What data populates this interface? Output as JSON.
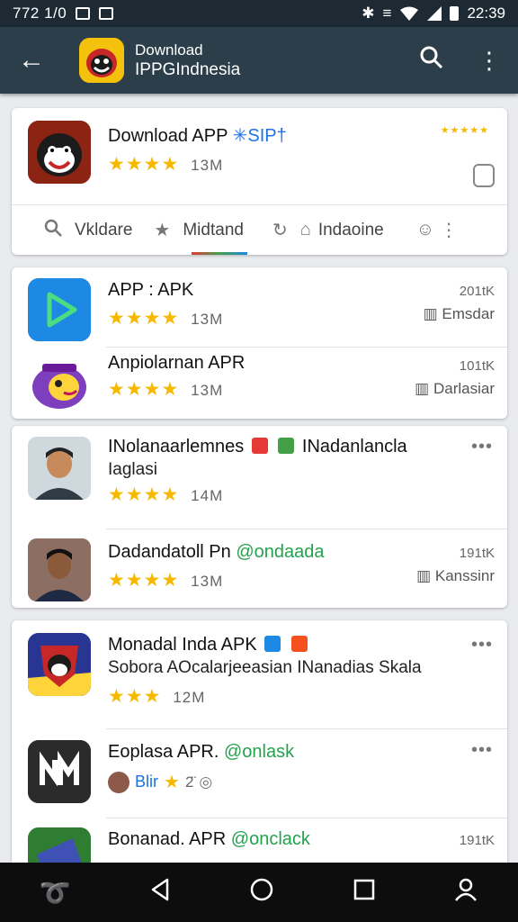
{
  "status_bar": {
    "time_left": "772 1/0",
    "time_right": "22:39"
  },
  "app_bar": {
    "title_line1": "Download",
    "title_line2": "IPPGIndnesia"
  },
  "featured": {
    "name": "Download APP",
    "tag": "✳SIP†",
    "stars": "★★★★",
    "meta": "13M",
    "small_stars": "★★★★★"
  },
  "tabs": [
    {
      "label": "Vkldare"
    },
    {
      "label": "Midtand"
    },
    {
      "label": "Indaoine"
    }
  ],
  "apps": [
    {
      "name": "APP : APK",
      "stars": "★★★★",
      "meta": "13M",
      "size": "201tK",
      "location": "Emsdar"
    },
    {
      "name": "Anpiolarnan APR",
      "stars": "★★★★",
      "meta": "13M",
      "size": "101tK",
      "location": "Darlasiar"
    },
    {
      "name": "INolanaarlemnes",
      "name_tail": "INadanlancla",
      "line2": "Iaglasi",
      "stars": "★★★★",
      "meta": "14M"
    },
    {
      "name": "Dadandatoll Pn",
      "tag": "@ondaada",
      "stars": "★★★★",
      "meta": "13M",
      "size": "191tK",
      "location": "Kanssinr"
    },
    {
      "name": "Monadal Inda APK",
      "line2": "Sobora  AOcalarjeeasian INanadias Skala",
      "stars": "★★★",
      "meta": "12M"
    },
    {
      "name": "Eoplasa APR.",
      "tag": "@onlask",
      "line2": "Blir",
      "meta": "2̈"
    },
    {
      "name": "Bonanad. APR",
      "tag": "@onclack",
      "size": "191tK"
    }
  ]
}
